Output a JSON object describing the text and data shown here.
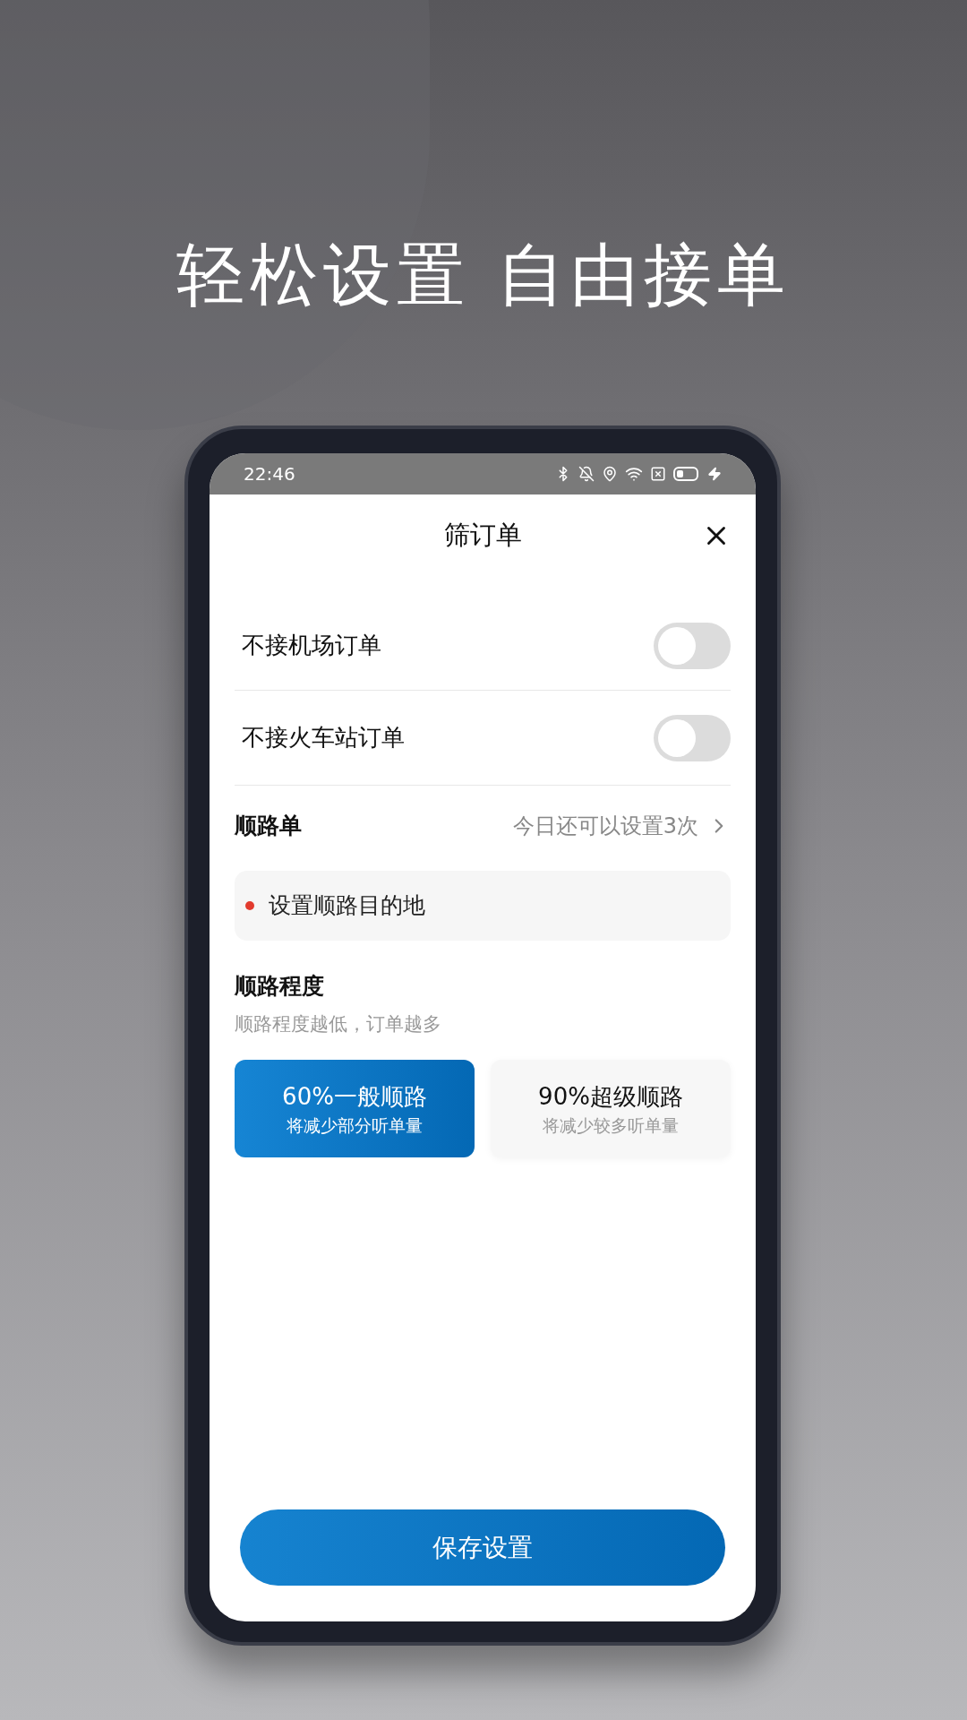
{
  "headline": "轻松设置 自由接单",
  "status_bar": {
    "time": "22:46"
  },
  "header": {
    "title": "筛订单"
  },
  "toggles": [
    {
      "label": "不接机场订单",
      "on": false
    },
    {
      "label": "不接火车站订单",
      "on": false
    }
  ],
  "route_order": {
    "title": "顺路单",
    "remaining": "今日还可以设置3次",
    "destination": "设置顺路目的地"
  },
  "route_degree": {
    "title": "顺路程度",
    "hint": "顺路程度越低，订单越多",
    "options": [
      {
        "title": "60%一般顺路",
        "subtitle": "将减少部分听单量",
        "selected": true
      },
      {
        "title": "90%超级顺路",
        "subtitle": "将减少较多听单量",
        "selected": false
      }
    ]
  },
  "save_button": "保存设置"
}
